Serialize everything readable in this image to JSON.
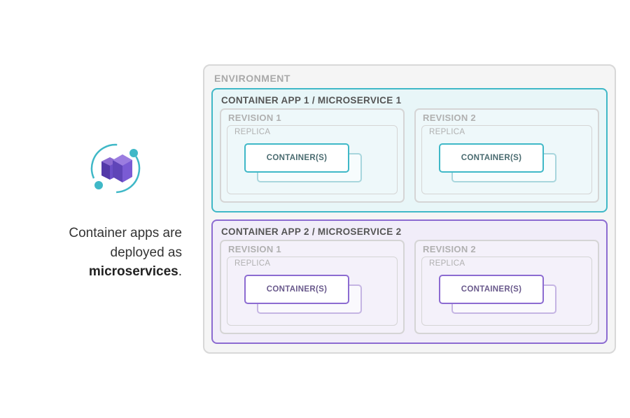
{
  "tagline": {
    "line1": "Container apps are",
    "line2": "deployed as",
    "strong": "microservices",
    "suffix": "."
  },
  "env": {
    "label": "ENVIRONMENT"
  },
  "apps": [
    {
      "title": "CONTAINER APP 1 / MICROSERVICE 1",
      "color": "teal",
      "revisions": [
        {
          "label": "REVISION 1",
          "replica": "REPLICA",
          "container": "CONTAINER(S)"
        },
        {
          "label": "REVISION 2",
          "replica": "REPLICA",
          "container": "CONTAINER(S)"
        }
      ]
    },
    {
      "title": "CONTAINER APP 2 / MICROSERVICE 2",
      "color": "purple",
      "revisions": [
        {
          "label": "REVISION 1",
          "replica": "REPLICA",
          "container": "CONTAINER(S)"
        },
        {
          "label": "REVISION 2",
          "replica": "REPLICA",
          "container": "CONTAINER(S)"
        }
      ]
    }
  ]
}
